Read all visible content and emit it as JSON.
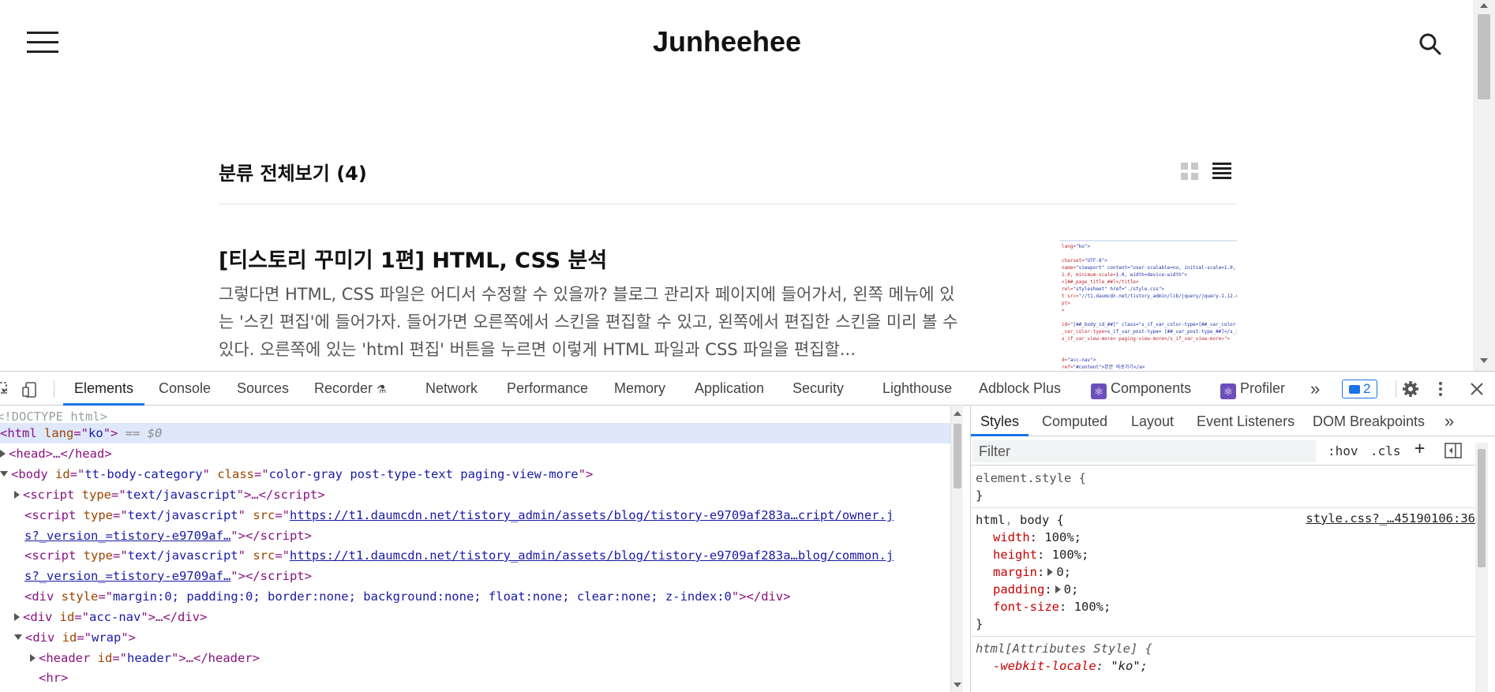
{
  "site": {
    "title": "Junheehee",
    "category_heading": "분류 전체보기 (4)"
  },
  "post": {
    "title": "[티스토리 꾸미기 1편] HTML, CSS 분석",
    "excerpt": "그렇다면 HTML, CSS 파일은 어디서 수정할 수 있을까? 블로그 관리자 페이지에 들어가서, 왼쪽 메뉴에 있는 '스킨 편집'에 들어가자. 들어가면 오른쪽에서 스킨을 편집할 수 있고, 왼쪽에서 편집한 스킨을 미리 볼 수 있다. 오른쪽에 있는 'html 편집' 버튼을 누르면 이렇게 HTML 파일과 CSS 파일을 편집할..."
  },
  "thumbnail_lines": [
    "lang=\"ko\">",
    "",
    "charset=\"UTF-8\">",
    "name=\"viewport\" content=\"user-scalable=no, initial-scale=1.0, ma",
    "1.0, minimum-scale=1.0, width=device-width\">",
    ">[##_page_title_##]</title>",
    "rel=\"stylesheet\" href=\"./style.css\">",
    "t src=\"//t1.daumcdn.net/tistory_admin/lib/jquery/jquery-1.12.4.m",
    "pt>",
    ">",
    "",
    "id=\"[##_body_id_##]\" class=\"s_if_var_color-type=[##_var_color-t",
    "_var_color-type=s_if_var_post-type= [##_var_post-type_##]</s_if_",
    "s_if_var_view-more> paging-view-more</s_if_var_view-more>\">",
    "",
    "",
    "d=\"acc-nav\">",
    "ref=\"#content\">본문 바로가기</a>"
  ],
  "devtools": {
    "tabs": [
      "Elements",
      "Console",
      "Sources",
      "Recorder",
      "Network",
      "Performance",
      "Memory",
      "Application",
      "Security",
      "Lighthouse",
      "Adblock Plus",
      "Components",
      "Profiler"
    ],
    "issues_count": "2",
    "elements": {
      "doctype": "<!DOCTYPE html>",
      "html_tag": "html",
      "html_lang_attr": "lang",
      "html_lang_val": "ko",
      "selected_marker": "== $0",
      "head_text": "<head>…</head>",
      "body_id": "tt-body-category",
      "body_class": "color-gray post-type-text paging-view-more",
      "script1_type": "text/javascript",
      "script2_src_line1": "https://t1.daumcdn.net/tistory_admin/assets/blog/tistory-e9709af283a…cript/owner.j",
      "script2_src_line2": "s?_version_=tistory-e9709af…",
      "script3_src_line1": "https://t1.daumcdn.net/tistory_admin/assets/blog/tistory-e9709af283a…blog/common.j",
      "script3_src_line2": "s?_version_=tistory-e9709af…",
      "div_style": "margin:0; padding:0; border:none; background:none; float:none; clear:none; z-index:0",
      "div_acc_id": "acc-nav",
      "div_wrap_id": "wrap",
      "header_id": "header",
      "hr_text": "<hr>"
    },
    "styles": {
      "subtabs": [
        "Styles",
        "Computed",
        "Layout",
        "Event Listeners",
        "DOM Breakpoints"
      ],
      "filter_placeholder": "Filter",
      "hov": ":hov",
      "cls": ".cls",
      "element_style": "element.style {",
      "close_brace": "}",
      "rule2_selector_a": "html",
      "rule2_selector_b": "body",
      "rule2_source": "style.css?_…45190106:36",
      "rule2_props": [
        {
          "name": "width",
          "value": "100%;"
        },
        {
          "name": "height",
          "value": "100%;"
        },
        {
          "name": "margin",
          "value": "0;"
        },
        {
          "name": "padding",
          "value": "0;"
        },
        {
          "name": "font-size",
          "value": "100%;"
        }
      ],
      "rule3_selector": "html[Attributes Style] {",
      "rule3_prop_name": "-webkit-locale",
      "rule3_prop_value": "\"ko\";"
    }
  }
}
